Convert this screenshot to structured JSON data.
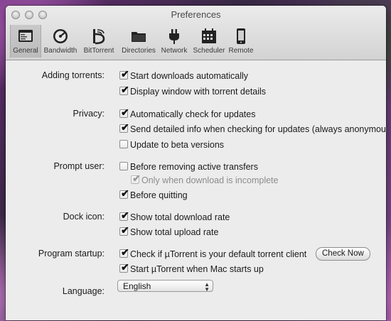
{
  "window": {
    "title": "Preferences"
  },
  "toolbar": {
    "items": [
      {
        "label": "General",
        "icon": "general-icon"
      },
      {
        "label": "Bandwidth",
        "icon": "gauge-icon"
      },
      {
        "label": "BitTorrent",
        "icon": "bittorrent-icon"
      },
      {
        "label": "Directories",
        "icon": "folder-icon"
      },
      {
        "label": "Network",
        "icon": "plug-icon"
      },
      {
        "label": "Scheduler",
        "icon": "calendar-icon"
      },
      {
        "label": "Remote",
        "icon": "phone-icon"
      }
    ],
    "selected": "General"
  },
  "sections": {
    "adding": {
      "label": "Adding torrents:",
      "start_downloads": {
        "label": "Start downloads automatically",
        "checked": true
      },
      "display_window": {
        "label": "Display window with torrent details",
        "checked": true
      }
    },
    "privacy": {
      "label": "Privacy:",
      "check_updates": {
        "label": "Automatically check for updates",
        "checked": true
      },
      "send_info": {
        "label": "Send detailed info when checking for updates (always anonymous)",
        "checked": true
      },
      "beta": {
        "label": "Update to beta versions",
        "checked": false
      }
    },
    "prompt": {
      "label": "Prompt user:",
      "removing": {
        "label": "Before removing active transfers",
        "checked": false
      },
      "incomplete": {
        "label": "Only when download is incomplete",
        "checked": true,
        "disabled": true
      },
      "quitting": {
        "label": "Before quitting",
        "checked": true
      }
    },
    "dock": {
      "label": "Dock icon:",
      "download_rate": {
        "label": "Show total download rate",
        "checked": true
      },
      "upload_rate": {
        "label": "Show total upload rate",
        "checked": true
      }
    },
    "startup": {
      "label": "Program startup:",
      "default_client": {
        "label": "Check if µTorrent is your default torrent client",
        "checked": true
      },
      "check_now": "Check Now",
      "start_on_login": {
        "label": "Start µTorrent when Mac starts up",
        "checked": true
      }
    },
    "language": {
      "label": "Language:",
      "selected": "English"
    }
  },
  "check_glyph": "✔"
}
